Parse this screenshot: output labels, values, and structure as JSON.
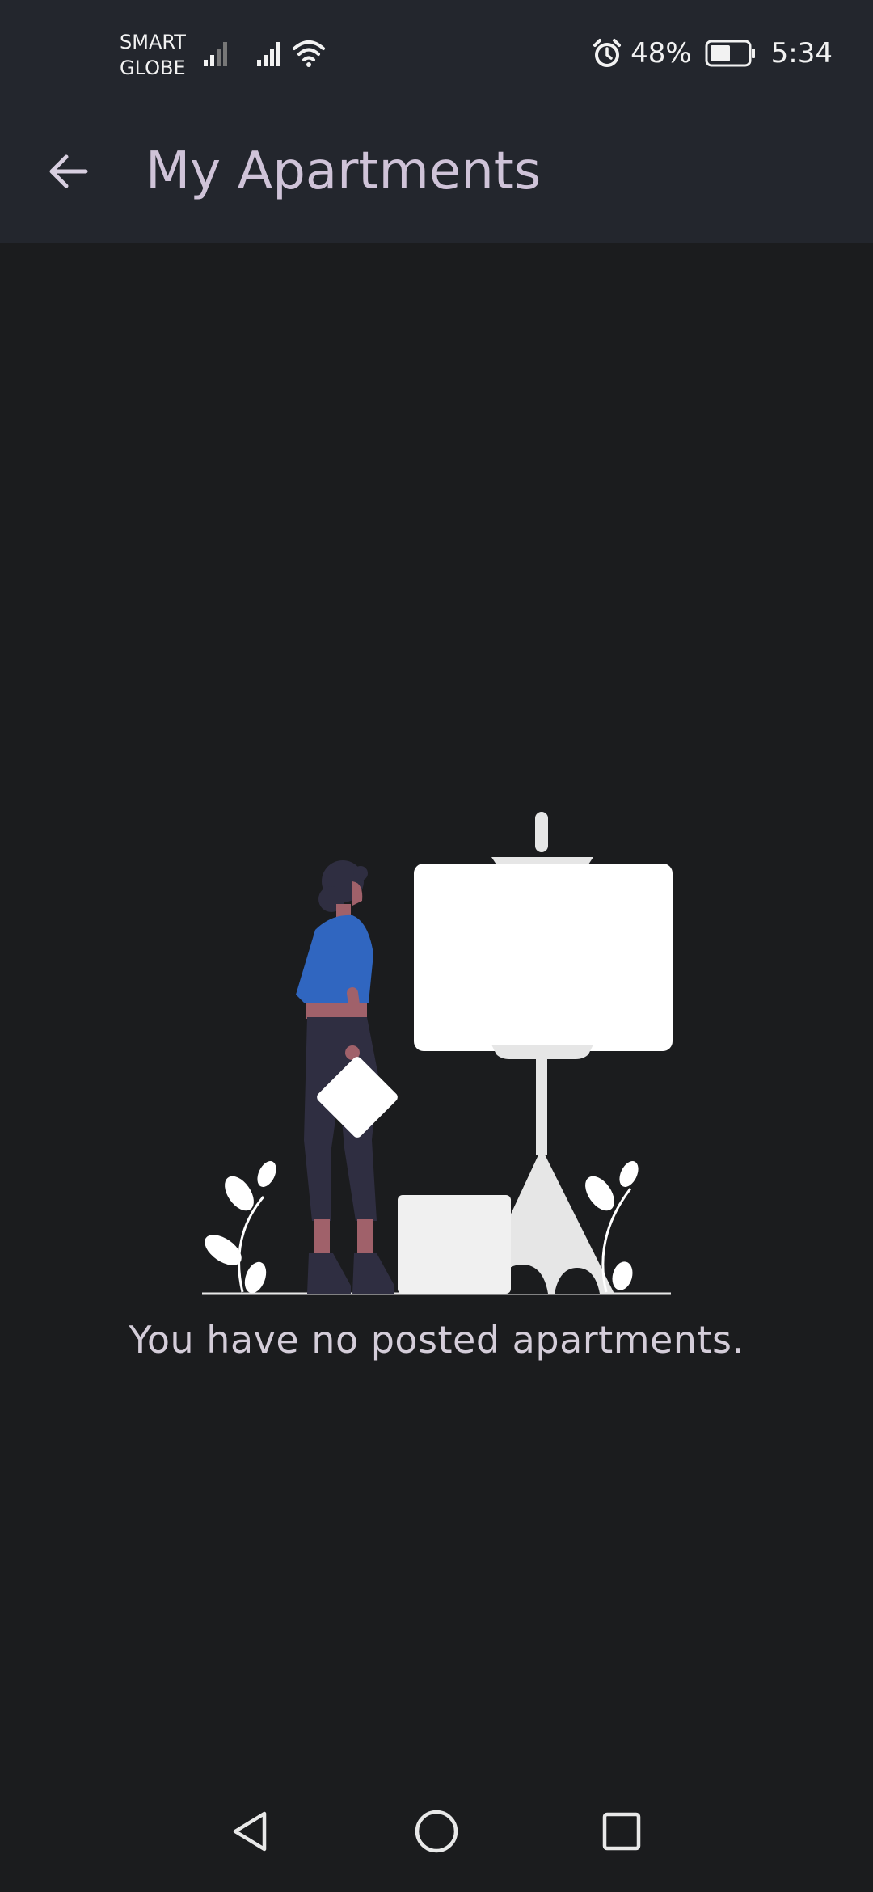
{
  "status_bar": {
    "carrier_line1": "SMART",
    "carrier_line2": "GLOBE",
    "battery_percent": "48%",
    "time": "5:34",
    "icons": [
      "signal-icon",
      "signal-icon",
      "wifi-icon",
      "alarm-icon",
      "battery-icon"
    ]
  },
  "app_bar": {
    "title": "My Apartments",
    "back_icon": "arrow-left-icon"
  },
  "empty_state": {
    "message": "You have no posted apartments.",
    "illustration": "woman-with-easel-illustration"
  },
  "nav_bar": {
    "icons": [
      "triangle-back-icon",
      "circle-home-icon",
      "square-recents-icon"
    ]
  },
  "colors": {
    "background": "#1b1c1e",
    "app_bar": "#23262d",
    "title": "#cfc3d8",
    "message": "#d4cdd9"
  }
}
